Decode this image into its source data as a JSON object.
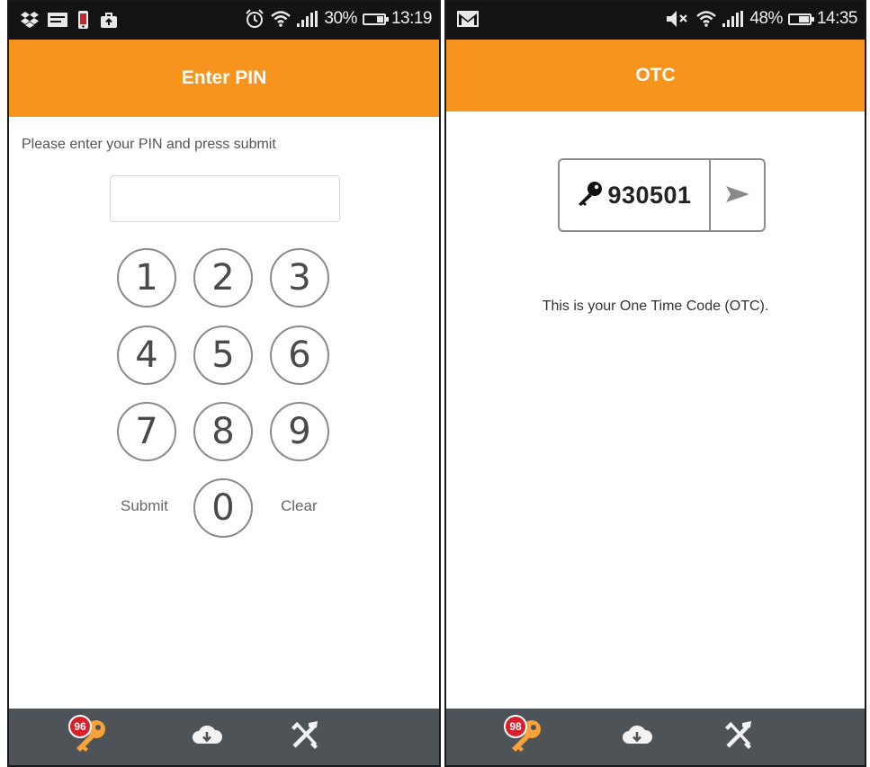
{
  "left_screen": {
    "status_bar": {
      "battery": "30%",
      "time": "13:19"
    },
    "title": "Enter PIN",
    "instruction": "Please enter your PIN and press submit",
    "pin_input": {
      "value": "",
      "placeholder": ""
    },
    "keypad": {
      "keys": [
        "1",
        "2",
        "3",
        "4",
        "5",
        "6",
        "7",
        "8",
        "9",
        "0"
      ],
      "submit_label": "Submit",
      "clear_label": "Clear"
    },
    "bottom_nav": {
      "badge_count": "96",
      "tabs": [
        "key-icon",
        "cloud-download-icon",
        "tools-icon"
      ]
    }
  },
  "right_screen": {
    "status_bar": {
      "battery": "48%",
      "time": "14:35"
    },
    "title": "OTC",
    "otc_code": "930501",
    "caption": "This is your One Time Code (OTC).",
    "bottom_nav": {
      "badge_count": "98",
      "tabs": [
        "key-icon",
        "cloud-download-icon",
        "tools-icon"
      ]
    }
  },
  "colors": {
    "accent_orange": "#f7941d",
    "status_bar": "#131313",
    "bottom_bar": "#4e5358",
    "badge_red": "#d9202a",
    "key_icon_orange": "#f5a33a"
  }
}
